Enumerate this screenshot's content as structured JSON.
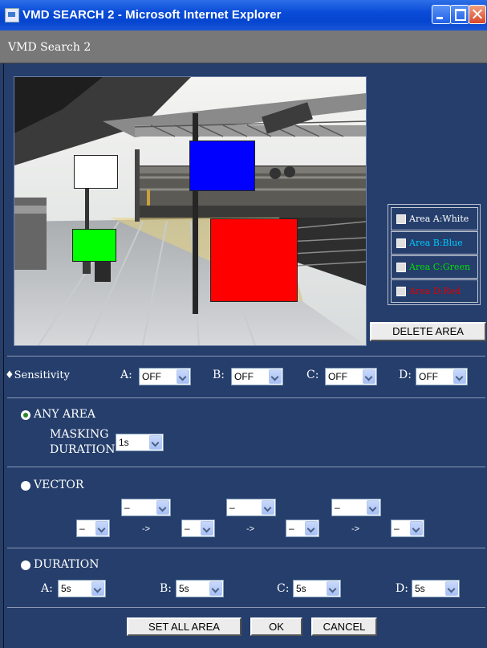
{
  "window": {
    "title": "VMD SEARCH 2 - Microsoft Internet Explorer"
  },
  "header": {
    "title": "VMD Search 2"
  },
  "areas": {
    "legend": [
      {
        "label": "Area A:White",
        "color": "#ffffff"
      },
      {
        "label": "Area B:Blue",
        "color": "#00c8ff"
      },
      {
        "label": "Area C:Green",
        "color": "#00e000"
      },
      {
        "label": "Area D:Red",
        "color": "#e00000"
      }
    ],
    "box_colors": {
      "a": "#ffffff",
      "b": "#0000ff",
      "c": "#00ff00",
      "d": "#ff0000"
    }
  },
  "delete_area_label": "DELETE AREA",
  "sensitivity": {
    "label": "♦Sensitivity",
    "channels": [
      {
        "label": "A:",
        "value": "OFF"
      },
      {
        "label": "B:",
        "value": "OFF"
      },
      {
        "label": "C:",
        "value": "OFF"
      },
      {
        "label": "D:",
        "value": "OFF"
      }
    ]
  },
  "any_area": {
    "label": "ANY AREA",
    "selected": true,
    "masking_line1": "MASKING",
    "masking_line2": "DURATION",
    "masking_value": "1s"
  },
  "vector": {
    "label": "VECTOR",
    "selected": false,
    "top_values": [
      "–",
      "–",
      "–"
    ],
    "bottom_values": [
      "–",
      "–",
      "–",
      "–"
    ],
    "arrow": "->"
  },
  "duration": {
    "label": "DURATION",
    "selected": false,
    "channels": [
      {
        "label": "A:",
        "value": "5s"
      },
      {
        "label": "B:",
        "value": "5s"
      },
      {
        "label": "C:",
        "value": "5s"
      },
      {
        "label": "D:",
        "value": "5s"
      }
    ]
  },
  "footer": {
    "set_all_area": "SET ALL AREA",
    "ok": "OK",
    "cancel": "CANCEL"
  }
}
